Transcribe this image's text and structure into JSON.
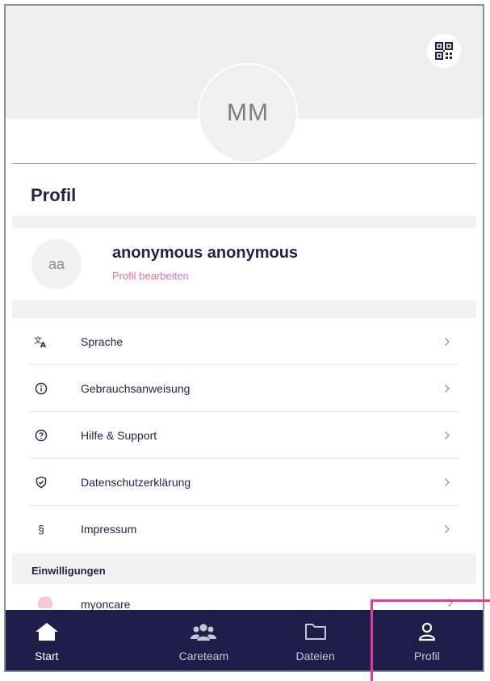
{
  "header": {
    "avatar_initials": "MM",
    "qr_icon": "qr-code-icon"
  },
  "page": {
    "title": "Profil"
  },
  "user": {
    "initials": "aa",
    "name": "anonymous anonymous",
    "edit_label": "Profil bearbeiten"
  },
  "menu": [
    {
      "label": "Sprache",
      "icon": "translate-icon"
    },
    {
      "label": "Gebrauchsanweisung",
      "icon": "info-icon"
    },
    {
      "label": "Hilfe & Support",
      "icon": "help-icon"
    },
    {
      "label": "Datenschutzerklärung",
      "icon": "shield-check-icon"
    },
    {
      "label": "Impressum",
      "icon": "paragraph-icon",
      "glyph": "§"
    }
  ],
  "consents": {
    "title": "Einwilligungen",
    "items": [
      {
        "label": "myoncare",
        "icon": "heart-icon"
      }
    ]
  },
  "tabs": [
    {
      "label": "Start",
      "icon": "home-icon",
      "active": true
    },
    {
      "label": "Careteam",
      "icon": "team-icon",
      "active": false
    },
    {
      "label": "Dateien",
      "icon": "folder-icon",
      "active": false
    },
    {
      "label": "Profil",
      "icon": "user-icon",
      "active": false
    }
  ],
  "colors": {
    "navy": "#1f1d4a",
    "pink": "#e36fa8",
    "highlight": "#e23c9a",
    "background": "#efefef"
  }
}
